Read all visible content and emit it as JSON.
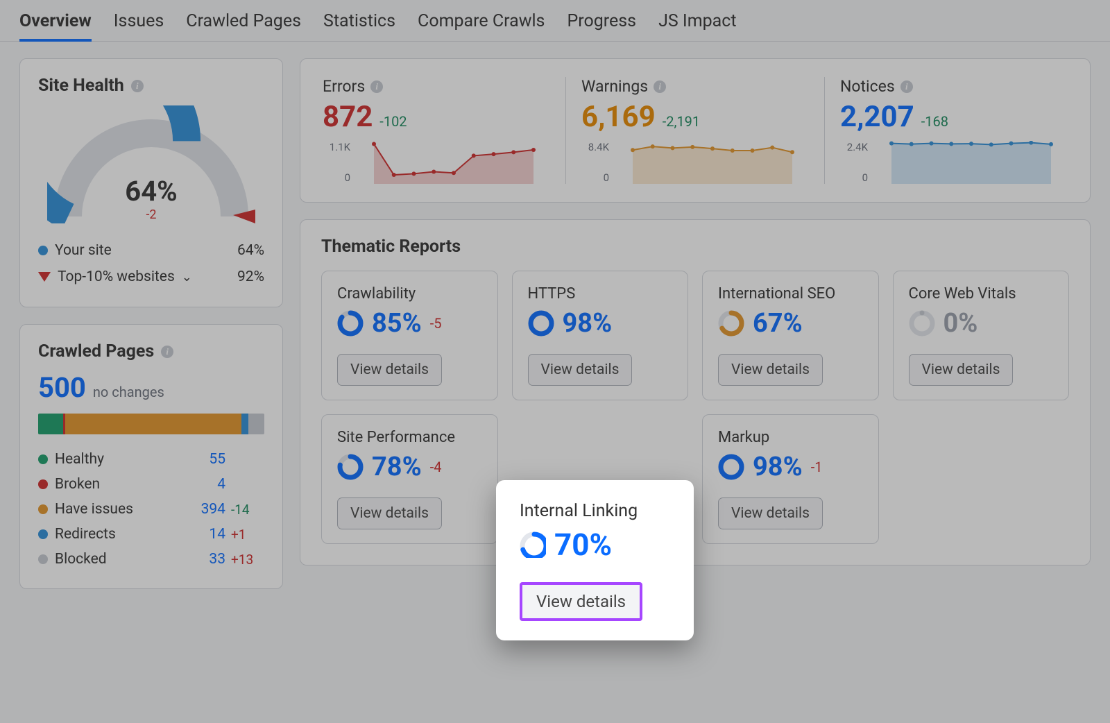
{
  "tabs": [
    "Overview",
    "Issues",
    "Crawled Pages",
    "Statistics",
    "Compare Crawls",
    "Progress",
    "JS Impact"
  ],
  "active_tab_index": 0,
  "site_health": {
    "title": "Site Health",
    "percent": "64%",
    "delta": "-2",
    "gauge_fill_pct": 64,
    "legend": [
      {
        "type": "dot",
        "color": "#2f8fd9",
        "label": "Your site",
        "value": "64%"
      },
      {
        "type": "tri",
        "label": "Top-10% websites",
        "value": "92%",
        "chevron": true
      }
    ]
  },
  "top_metrics": {
    "errors": {
      "title": "Errors",
      "value": "872",
      "delta": "-102",
      "ymax": "1.1K",
      "ymin": "0"
    },
    "warnings": {
      "title": "Warnings",
      "value": "6,169",
      "delta": "-2,191",
      "ymax": "8.4K",
      "ymin": "0"
    },
    "notices": {
      "title": "Notices",
      "value": "2,207",
      "delta": "-168",
      "ymax": "2.4K",
      "ymin": "0"
    }
  },
  "crawled_pages": {
    "title": "Crawled Pages",
    "total": "500",
    "total_sub": "no changes",
    "segments": [
      {
        "color": "#1a9e6b",
        "pct": 11
      },
      {
        "color": "#cf2b2b",
        "pct": 1
      },
      {
        "color": "#e3962a",
        "pct": 78
      },
      {
        "color": "#2f8fd9",
        "pct": 3
      },
      {
        "color": "#c6cad1",
        "pct": 7
      }
    ],
    "rows": [
      {
        "color": "#1a9e6b",
        "label": "Healthy",
        "value": "55",
        "delta": ""
      },
      {
        "color": "#cf2b2b",
        "label": "Broken",
        "value": "4",
        "delta": ""
      },
      {
        "color": "#e3962a",
        "label": "Have issues",
        "value": "394",
        "delta": "-14",
        "delta_class": "delta-neg"
      },
      {
        "color": "#2f8fd9",
        "label": "Redirects",
        "value": "14",
        "delta": "+1",
        "delta_class": "delta-pos"
      },
      {
        "color": "#c6cad1",
        "label": "Blocked",
        "value": "33",
        "delta": "+13",
        "delta_class": "delta-pos"
      }
    ]
  },
  "reports_title": "Thematic Reports",
  "reports": [
    {
      "title": "Crawlability",
      "pct": "85%",
      "pct_num": 85,
      "delta": "-5",
      "btn": "View details",
      "color": "#0a6cff"
    },
    {
      "title": "HTTPS",
      "pct": "98%",
      "pct_num": 98,
      "delta": "",
      "btn": "View details",
      "color": "#0a6cff"
    },
    {
      "title": "International SEO",
      "pct": "67%",
      "pct_num": 67,
      "delta": "",
      "btn": "View details",
      "color": "#e3962a"
    },
    {
      "title": "Core Web Vitals",
      "pct": "0%",
      "pct_num": 0,
      "delta": "",
      "btn": "View details",
      "color": "#c6cad1"
    },
    {
      "title": "Site Performance",
      "pct": "78%",
      "pct_num": 78,
      "delta": "-4",
      "btn": "View details",
      "color": "#0a6cff"
    },
    {
      "title": "Internal Linking",
      "pct": "70%",
      "pct_num": 70,
      "delta": "",
      "btn": "View details",
      "color": "#0a6cff",
      "highlight": true
    },
    {
      "title": "Markup",
      "pct": "98%",
      "pct_num": 98,
      "delta": "-1",
      "btn": "View details",
      "color": "#0a6cff"
    }
  ],
  "chart_data": [
    {
      "type": "line",
      "title": "Errors",
      "ylim": [
        0,
        1100
      ],
      "x": [
        1,
        2,
        3,
        4,
        5,
        6,
        7,
        8,
        9
      ],
      "values": [
        1020,
        230,
        260,
        310,
        280,
        720,
        760,
        810,
        870
      ],
      "color": "#cf2b2b"
    },
    {
      "type": "line",
      "title": "Warnings",
      "ylim": [
        0,
        8400
      ],
      "x": [
        1,
        2,
        3,
        4,
        5,
        6,
        7,
        8,
        9
      ],
      "values": [
        6600,
        7300,
        7000,
        7200,
        6900,
        6500,
        6500,
        7100,
        6200
      ],
      "color": "#e3962a"
    },
    {
      "type": "line",
      "title": "Notices",
      "ylim": [
        0,
        2400
      ],
      "x": [
        1,
        2,
        3,
        4,
        5,
        6,
        7,
        8,
        9
      ],
      "values": [
        2260,
        2220,
        2260,
        2230,
        2240,
        2190,
        2260,
        2300,
        2210
      ],
      "color": "#2f8fd9"
    }
  ]
}
